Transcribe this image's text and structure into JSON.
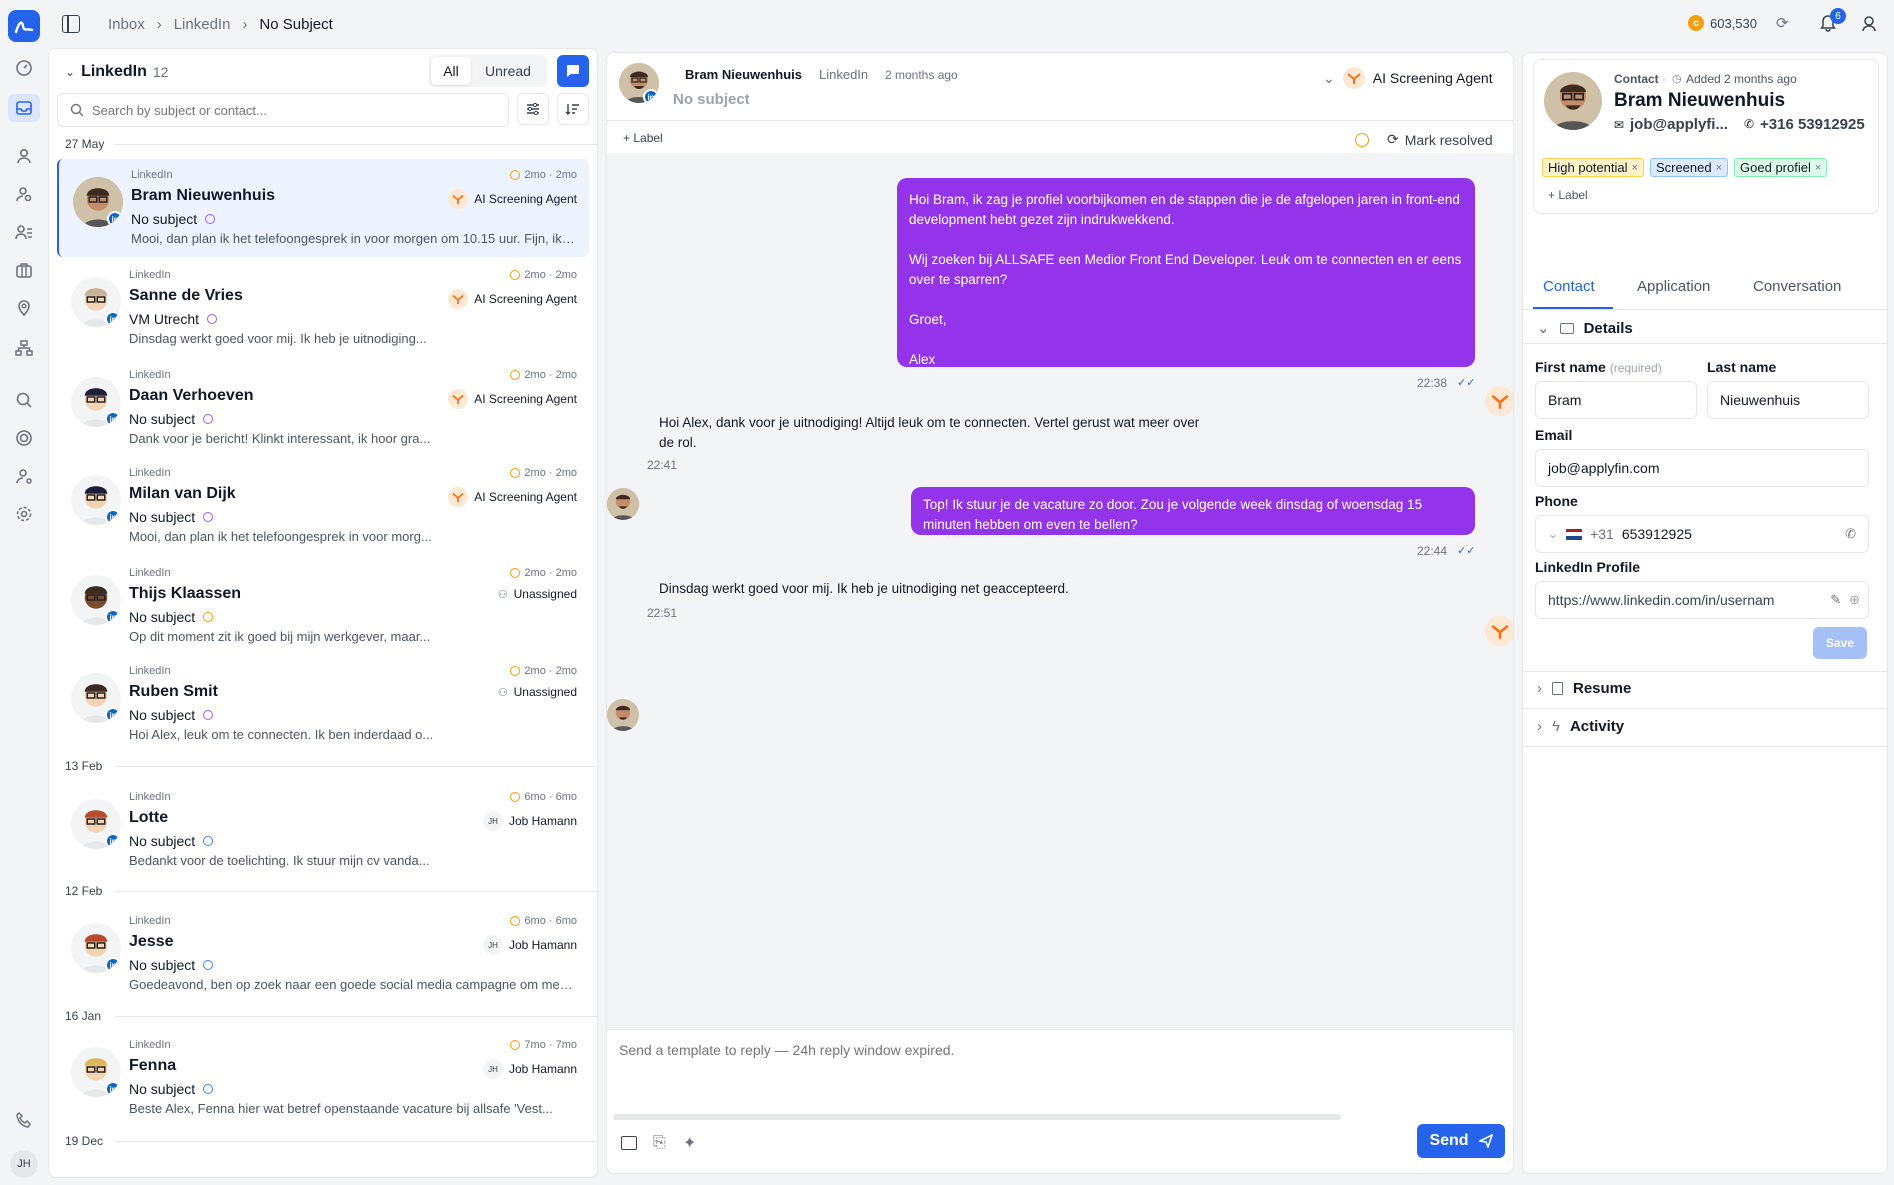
{
  "breadcrumb": {
    "items": [
      "Inbox",
      "LinkedIn",
      "No Subject"
    ]
  },
  "header": {
    "credits": "603,530",
    "notif_count": "6"
  },
  "rail": {
    "user_initials": "JH"
  },
  "list": {
    "title": "LinkedIn",
    "count": "12",
    "filter_all": "All",
    "filter_unread": "Unread",
    "search_placeholder": "Search by subject or contact...",
    "groups": [
      "27 May",
      "13 Feb",
      "12 Feb",
      "16 Jan",
      "19 Dec"
    ],
    "items": [
      {
        "source": "LinkedIn",
        "name": "Bram Nieuwenhuis",
        "subject": "No subject",
        "preview": "Mooi, dan plan ik het telefoongesprek in voor morgen om 10.15 uur. Fijn, ik ki...",
        "time": "2mo · 2mo",
        "assignee": "AI Screening Agent"
      },
      {
        "source": "LinkedIn",
        "name": "Sanne de Vries",
        "subject": "VM Utrecht",
        "preview": "Dinsdag werkt goed voor mij. Ik heb je uitnodiging...",
        "time": "2mo · 2mo",
        "assignee": "AI Screening Agent"
      },
      {
        "source": "LinkedIn",
        "name": "Daan Verhoeven",
        "subject": "No subject",
        "preview": "Dank voor je bericht! Klinkt interessant, ik hoor gra...",
        "time": "2mo · 2mo",
        "assignee": "AI Screening Agent"
      },
      {
        "source": "LinkedIn",
        "name": "Milan van Dijk",
        "subject": "No subject",
        "preview": "Mooi, dan plan ik het telefoongesprek in voor morg...",
        "time": "2mo · 2mo",
        "assignee": "AI Screening Agent"
      },
      {
        "source": "LinkedIn",
        "name": "Thijs Klaassen",
        "subject": "No subject",
        "preview": "Op dit moment zit ik goed bij mijn werkgever, maar...",
        "time": "2mo · 2mo",
        "assignee": "Unassigned"
      },
      {
        "source": "LinkedIn",
        "name": "Ruben Smit",
        "subject": "No subject",
        "preview": "Hoi Alex, leuk om te connecten. Ik ben inderdaad o...",
        "time": "2mo · 2mo",
        "assignee": "Unassigned"
      },
      {
        "source": "LinkedIn",
        "name": "Lotte",
        "subject": "No subject",
        "preview": "Bedankt voor de toelichting. Ik stuur mijn cv vanda...",
        "time": "6mo · 6mo",
        "assignee": "Job Hamann",
        "assignee_initials": "JH"
      },
      {
        "source": "LinkedIn",
        "name": "Jesse",
        "subject": "No subject",
        "preview": "Goedeavond, ben op zoek naar een goede social media campagne om mede...",
        "time": "6mo · 6mo",
        "assignee": "Job Hamann",
        "assignee_initials": "JH"
      },
      {
        "source": "LinkedIn",
        "name": "Fenna",
        "subject": "No subject",
        "preview": "Beste Alex, Fenna hier wat betref openstaande vacature bij allsafe 'Vest...",
        "time": "7mo · 7mo",
        "assignee": "Job Hamann",
        "assignee_initials": "JH"
      }
    ]
  },
  "chat": {
    "contact_name": "Bram Nieuwenhuis",
    "channel": "LinkedIn",
    "time_ago": "2 months ago",
    "subject": "No subject",
    "agent": "AI Screening Agent",
    "label_btn": "+ Label",
    "mark_resolved": "Mark resolved",
    "messages": [
      {
        "text": "Hoi Bram, ik zag je profiel voorbijkomen en de stappen die je de afgelopen jaren in front-end development hebt gezet zijn indrukwekkend.\n\nWij zoeken bij ALLSAFE een Medior Front End Developer. Leuk om te connecten en er eens over te sparren?\n\nGroet,\n\nAlex",
        "time": "22:38"
      },
      {
        "text": "Hoi Alex, dank voor je uitnodiging! Altijd leuk om te connecten. Vertel gerust wat meer over de rol.",
        "time": "22:41"
      },
      {
        "text": "Top! Ik stuur je de vacature zo door. Zou je volgende week dinsdag of woensdag 15 minuten hebben om even te bellen?",
        "time": "22:44"
      },
      {
        "text": "Dinsdag werkt goed voor mij. Ik heb je uitnodiging net geaccepteerd.",
        "time": "22:51"
      }
    ],
    "composer_placeholder": "Send a template to reply — 24h reply window expired.",
    "send_label": "Send"
  },
  "contact": {
    "kicker": "Contact",
    "added": "Added 2 months ago",
    "name": "Bram Nieuwenhuis",
    "email_short": "job@applyfi...",
    "phone_short": "+316 53912925",
    "tags": [
      {
        "label": "High potential",
        "color": "#fef3c7",
        "border": "#fcd34d"
      },
      {
        "label": "Screened",
        "color": "#dbeafe",
        "border": "#93c5fd"
      },
      {
        "label": "Goed profiel",
        "color": "#dcfce7",
        "border": "#86efac"
      }
    ],
    "label_btn": "+ Label",
    "tabs": [
      "Contact",
      "Application",
      "Conversation"
    ],
    "details_title": "Details",
    "first_name_label": "First name",
    "required_label": "(required)",
    "last_name_label": "Last name",
    "first_name": "Bram",
    "last_name": "Nieuwenhuis",
    "email_label": "Email",
    "email": "job@applyfin.com",
    "phone_label": "Phone",
    "phone_cc": "+31",
    "phone": "653912925",
    "linkedin_label": "LinkedIn Profile",
    "linkedin": "https://www.linkedin.com/in/usernam",
    "save_label": "Save",
    "resume_label": "Resume",
    "activity_label": "Activity"
  },
  "colors": {
    "accent": "#2563eb",
    "purple": "#9333ea",
    "linkedin": "#0a66c2"
  }
}
